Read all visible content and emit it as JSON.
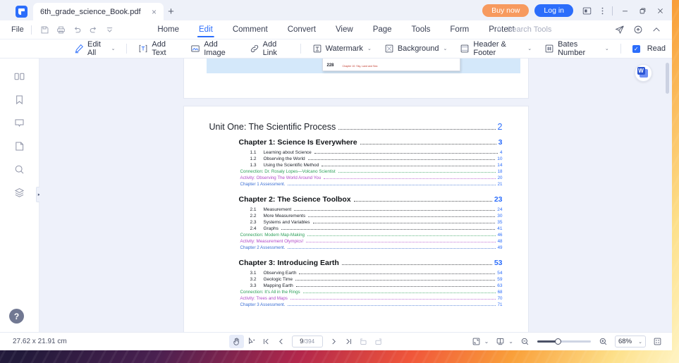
{
  "titlebar": {
    "tab_title": "6th_grade_science_Book.pdf",
    "tab_close": "×",
    "new_tab": "+",
    "buy_now": "Buy now",
    "log_in": "Log in",
    "minimize": "–",
    "maximize": "❐",
    "close": "✕"
  },
  "menubar": {
    "file": "File",
    "tabs": [
      {
        "label": "Home",
        "active": false
      },
      {
        "label": "Edit",
        "active": true
      },
      {
        "label": "Comment",
        "active": false
      },
      {
        "label": "Convert",
        "active": false
      },
      {
        "label": "View",
        "active": false
      },
      {
        "label": "Page",
        "active": false
      },
      {
        "label": "Tools",
        "active": false
      },
      {
        "label": "Form",
        "active": false
      },
      {
        "label": "Protect",
        "active": false
      }
    ],
    "search_tools": "Search Tools"
  },
  "ribbon": {
    "edit_all": "Edit All",
    "add_text": "Add Text",
    "add_image": "Add Image",
    "add_link": "Add Link",
    "watermark": "Watermark",
    "background": "Background",
    "header_footer": "Header & Footer",
    "bates_number": "Bates Number",
    "read": "Read",
    "caret": "⌄",
    "check": "✓"
  },
  "rail": {
    "items": [
      {
        "name": "thumbnails-icon"
      },
      {
        "name": "bookmark-icon"
      },
      {
        "name": "comment-icon"
      },
      {
        "name": "page-icon"
      },
      {
        "name": "search-icon"
      },
      {
        "name": "layers-icon"
      }
    ],
    "help": "?",
    "collapse": "▸"
  },
  "page_preview": {
    "page_number": "228",
    "caption": "Chapter 10: Sky, Land and Sea"
  },
  "document": {
    "unit": {
      "title": "Unit One: The Scientific Process",
      "page": "2"
    },
    "chapters": [
      {
        "title": "Chapter 1: Science Is Everywhere",
        "page": "3",
        "sections": [
          {
            "num": "1.1",
            "title": "Learning about Science",
            "page": "4"
          },
          {
            "num": "1.2",
            "title": "Observing the World",
            "page": "10"
          },
          {
            "num": "1.3",
            "title": "Using the Scientific Method",
            "page": "14"
          }
        ],
        "extras": [
          {
            "title": "Connection: Dr. Rosaly Lopes—Volcano Scientist",
            "page": "18",
            "kind": "connection"
          },
          {
            "title": "Activity: Observing The World Around You",
            "page": "20",
            "kind": "activity"
          },
          {
            "title": "Chapter 1 Assessment.",
            "page": "21",
            "kind": "assessment"
          }
        ]
      },
      {
        "title": "Chapter 2: The Science Toolbox",
        "page": "23",
        "sections": [
          {
            "num": "2.1",
            "title": "Measurement",
            "page": "24"
          },
          {
            "num": "2.2",
            "title": "More Measurements",
            "page": "30"
          },
          {
            "num": "2.3",
            "title": "Systems and Variables",
            "page": "35"
          },
          {
            "num": "2.4",
            "title": "Graphs",
            "page": "41"
          }
        ],
        "extras": [
          {
            "title": "Connection: Modern Map-Making",
            "page": "46",
            "kind": "connection"
          },
          {
            "title": "Activity:  Measurement Olympics!",
            "page": "48",
            "kind": "activity"
          },
          {
            "title": "Chapter 2 Assessment.",
            "page": "49",
            "kind": "assessment"
          }
        ]
      },
      {
        "title": "Chapter 3: Introducing Earth",
        "page": "53",
        "sections": [
          {
            "num": "3.1",
            "title": "Observing Earth",
            "page": "54"
          },
          {
            "num": "3.2",
            "title": "Geologic Time",
            "page": "59"
          },
          {
            "num": "3.3",
            "title": "Mapping Earth",
            "page": "63"
          }
        ],
        "extras": [
          {
            "title": "Connection: It's All in the Rings",
            "page": "68",
            "kind": "connection"
          },
          {
            "title": "Activity: Trees and Maps",
            "page": "70",
            "kind": "activity"
          },
          {
            "title": "Chapter 3 Assessment.",
            "page": "71",
            "kind": "assessment"
          }
        ]
      }
    ]
  },
  "fab": {
    "label": "W"
  },
  "statusbar": {
    "dimensions": "27.62 x 21.91 cm",
    "current_page": "9",
    "total_pages": "/394",
    "zoom": "68%",
    "caret": "⌄",
    "first_page": "|‹",
    "prev_page": "‹",
    "next_page": "›",
    "last_page": "›|"
  },
  "colors": {
    "accent_blue": "#2b6dfb",
    "buy_orange": "#f79a5f",
    "connection_green": "#2ea05a",
    "activity_purple": "#b048c8",
    "assessment_blue": "#3b6fd4",
    "page_bg": "#eef1fa"
  }
}
